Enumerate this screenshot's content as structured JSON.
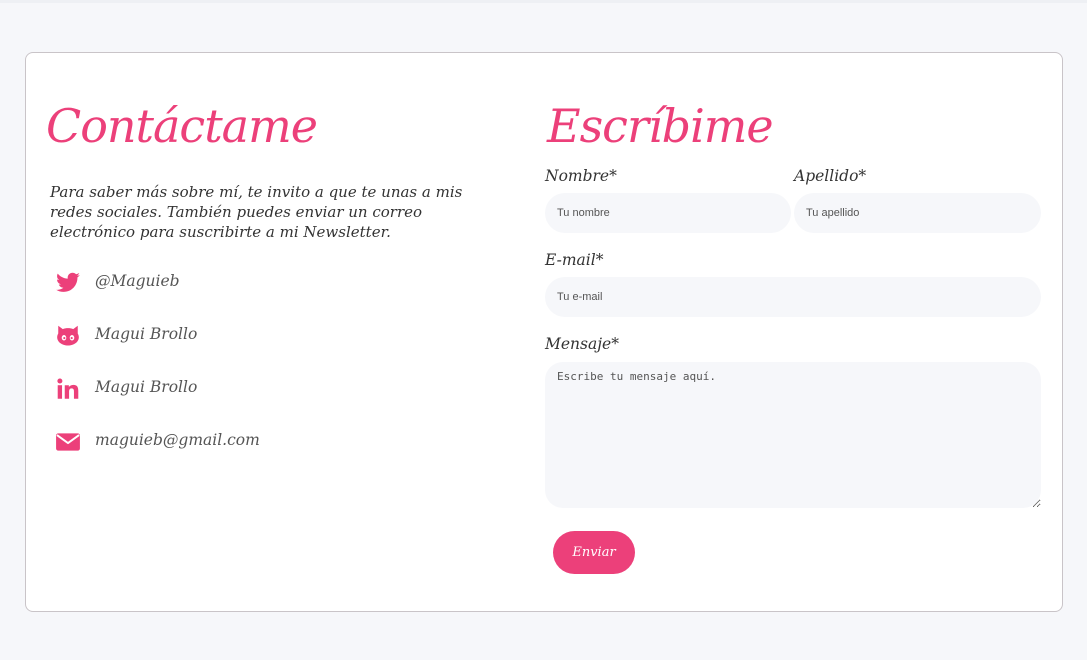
{
  "contact": {
    "title": "Contáctame",
    "intro": "Para saber más sobre mí, te invito a que te unas a mis redes sociales. También puedes enviar un correo electrónico para suscribirte a mi Newsletter.",
    "socials": [
      {
        "icon": "twitter-icon",
        "label": "@Maguieb"
      },
      {
        "icon": "github-icon",
        "label": "Magui Brollo"
      },
      {
        "icon": "linkedin-icon",
        "label": "Magui Brollo"
      },
      {
        "icon": "envelope-icon",
        "label": "maguieb@gmail.com"
      }
    ]
  },
  "form": {
    "title": "Escríbime",
    "first_name": {
      "label": "Nombre*",
      "placeholder": "Tu nombre",
      "value": ""
    },
    "last_name": {
      "label": "Apellido*",
      "placeholder": "Tu apellido",
      "value": ""
    },
    "email": {
      "label": "E-mail*",
      "placeholder": "Tu e-mail",
      "value": ""
    },
    "message": {
      "label": "Mensaje*",
      "placeholder": "Escribe tu mensaje aquí.",
      "value": ""
    },
    "submit_label": "Enviar"
  },
  "colors": {
    "accent": "#ec407a",
    "page_background": "#f6f7fa",
    "card_background": "#ffffff",
    "card_border": "#c9c4c8",
    "input_background": "#f6f7fa",
    "text": "#333333"
  }
}
